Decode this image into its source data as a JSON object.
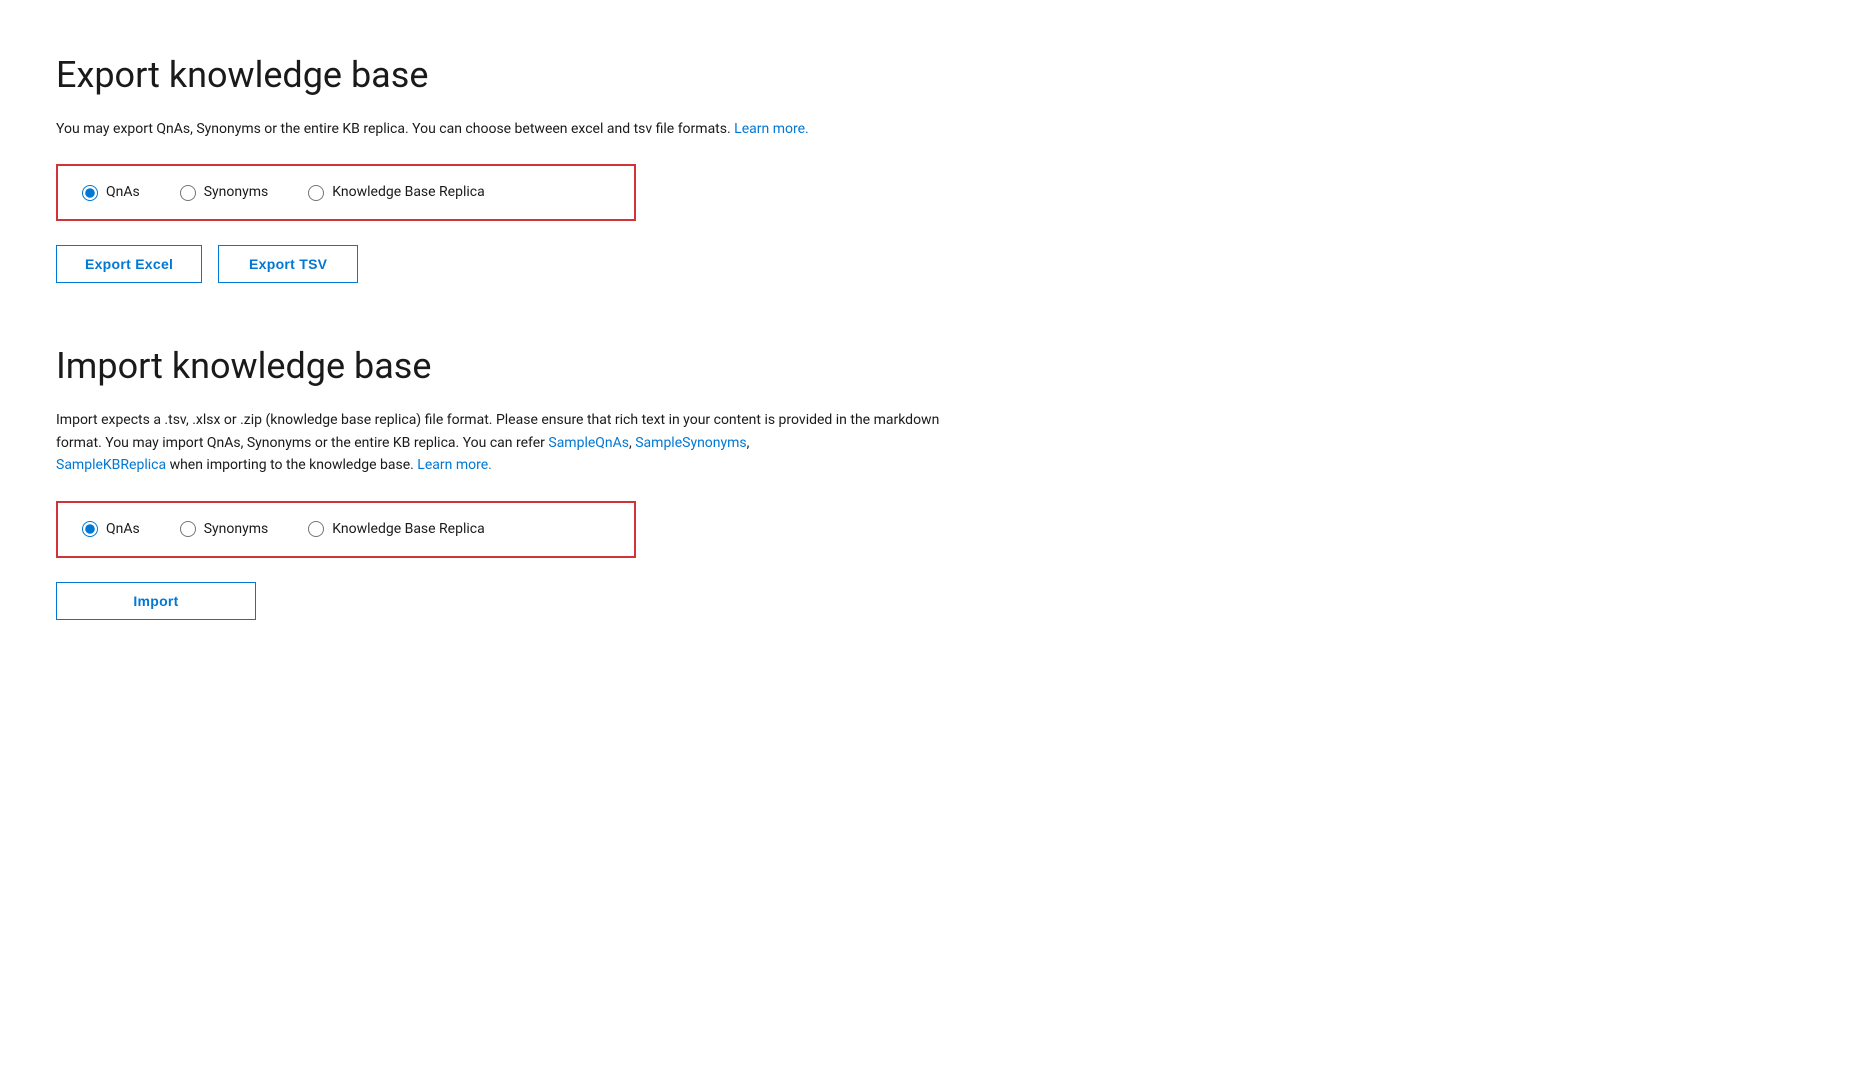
{
  "export_section": {
    "title": "Export knowledge base",
    "description": "You may export QnAs, Synonyms or the entire KB replica. You can choose between excel and tsv file formats.",
    "learn_more_link": "Learn more.",
    "radio_options": [
      {
        "id": "export-qnas",
        "label": "QnAs",
        "checked": true
      },
      {
        "id": "export-synonyms",
        "label": "Synonyms",
        "checked": false
      },
      {
        "id": "export-kbreplica",
        "label": "Knowledge Base Replica",
        "checked": false
      }
    ],
    "buttons": [
      {
        "id": "export-excel-btn",
        "label": "Export Excel"
      },
      {
        "id": "export-tsv-btn",
        "label": "Export TSV"
      }
    ]
  },
  "import_section": {
    "title": "Import knowledge base",
    "description_parts": {
      "before": "Import expects a .tsv, .xlsx or .zip (knowledge base replica) file format. Please ensure that rich text in your content is provided in the markdown format. You may import QnAs, Synonyms or the entire KB replica. You can refer",
      "link1_text": "SampleQnAs",
      "link2_text": "SampleSynonyms",
      "link3_text": "SampleKBReplica",
      "middle": "when importing to the knowledge base.",
      "learn_more_link": "Learn more."
    },
    "radio_options": [
      {
        "id": "import-qnas",
        "label": "QnAs",
        "checked": true
      },
      {
        "id": "import-synonyms",
        "label": "Synonyms",
        "checked": false
      },
      {
        "id": "import-kbreplica",
        "label": "Knowledge Base Replica",
        "checked": false
      }
    ],
    "import_button_label": "Import"
  }
}
